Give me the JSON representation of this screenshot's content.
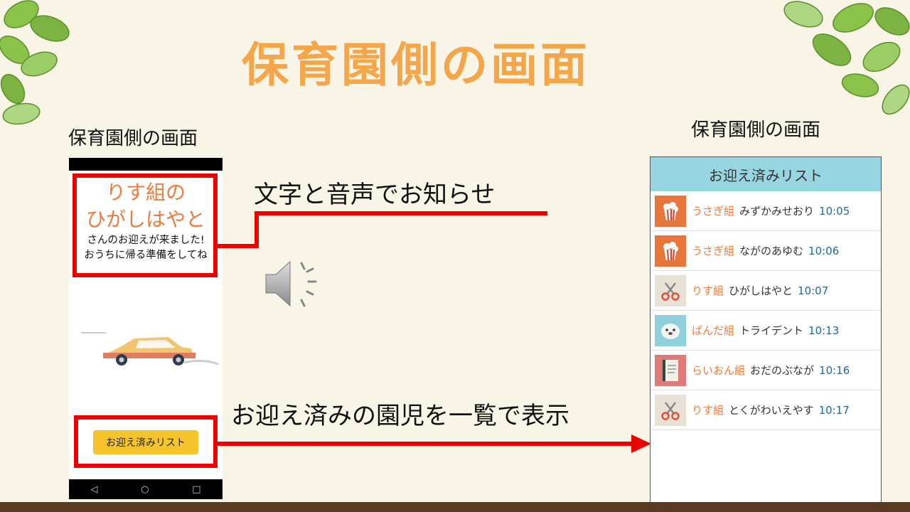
{
  "slide": {
    "title": "保育園側の画面",
    "caption_left": "保育園側の画面",
    "caption_right": "保育園側の画面",
    "annotation_notify": "文字と音声でお知らせ",
    "annotation_list": "お迎え済みの園児を一覧で表示"
  },
  "phone": {
    "class_name": "りす組の",
    "child_name": "ひがしはやと",
    "message_line1": "さんのお迎えが来ました!",
    "message_line2": "おうちに帰る準備をしてね",
    "button_label": "お迎え済みリスト",
    "nav_back": "◁",
    "nav_home": "○",
    "nav_recent": "□"
  },
  "list": {
    "header": "お迎え済みリスト",
    "items": [
      {
        "icon": "popcorn-icon",
        "class": "うさぎ組",
        "name": "みずかみせおり",
        "time": "10:05"
      },
      {
        "icon": "popcorn-icon",
        "class": "うさぎ組",
        "name": "ながのあゆむ",
        "time": "10:06"
      },
      {
        "icon": "scissors-icon",
        "class": "りす組",
        "name": "ひがしはやと",
        "time": "10:07"
      },
      {
        "icon": "seal-icon",
        "class": "ぱんだ組",
        "name": "トライデント",
        "time": "10:13"
      },
      {
        "icon": "notebook-icon",
        "class": "らいおん組",
        "name": "おだのぶなが",
        "time": "10:16"
      },
      {
        "icon": "scissors-icon",
        "class": "りす組",
        "name": "とくがわいえやす",
        "time": "10:17"
      }
    ]
  },
  "colors": {
    "background": "#f8f5e6",
    "title": "#f4a64b",
    "highlight": "#ee0000",
    "class_text": "#ef7b3f",
    "time_text": "#1b6aa0",
    "list_header": "#97d5e0",
    "button": "#f6c32c"
  }
}
